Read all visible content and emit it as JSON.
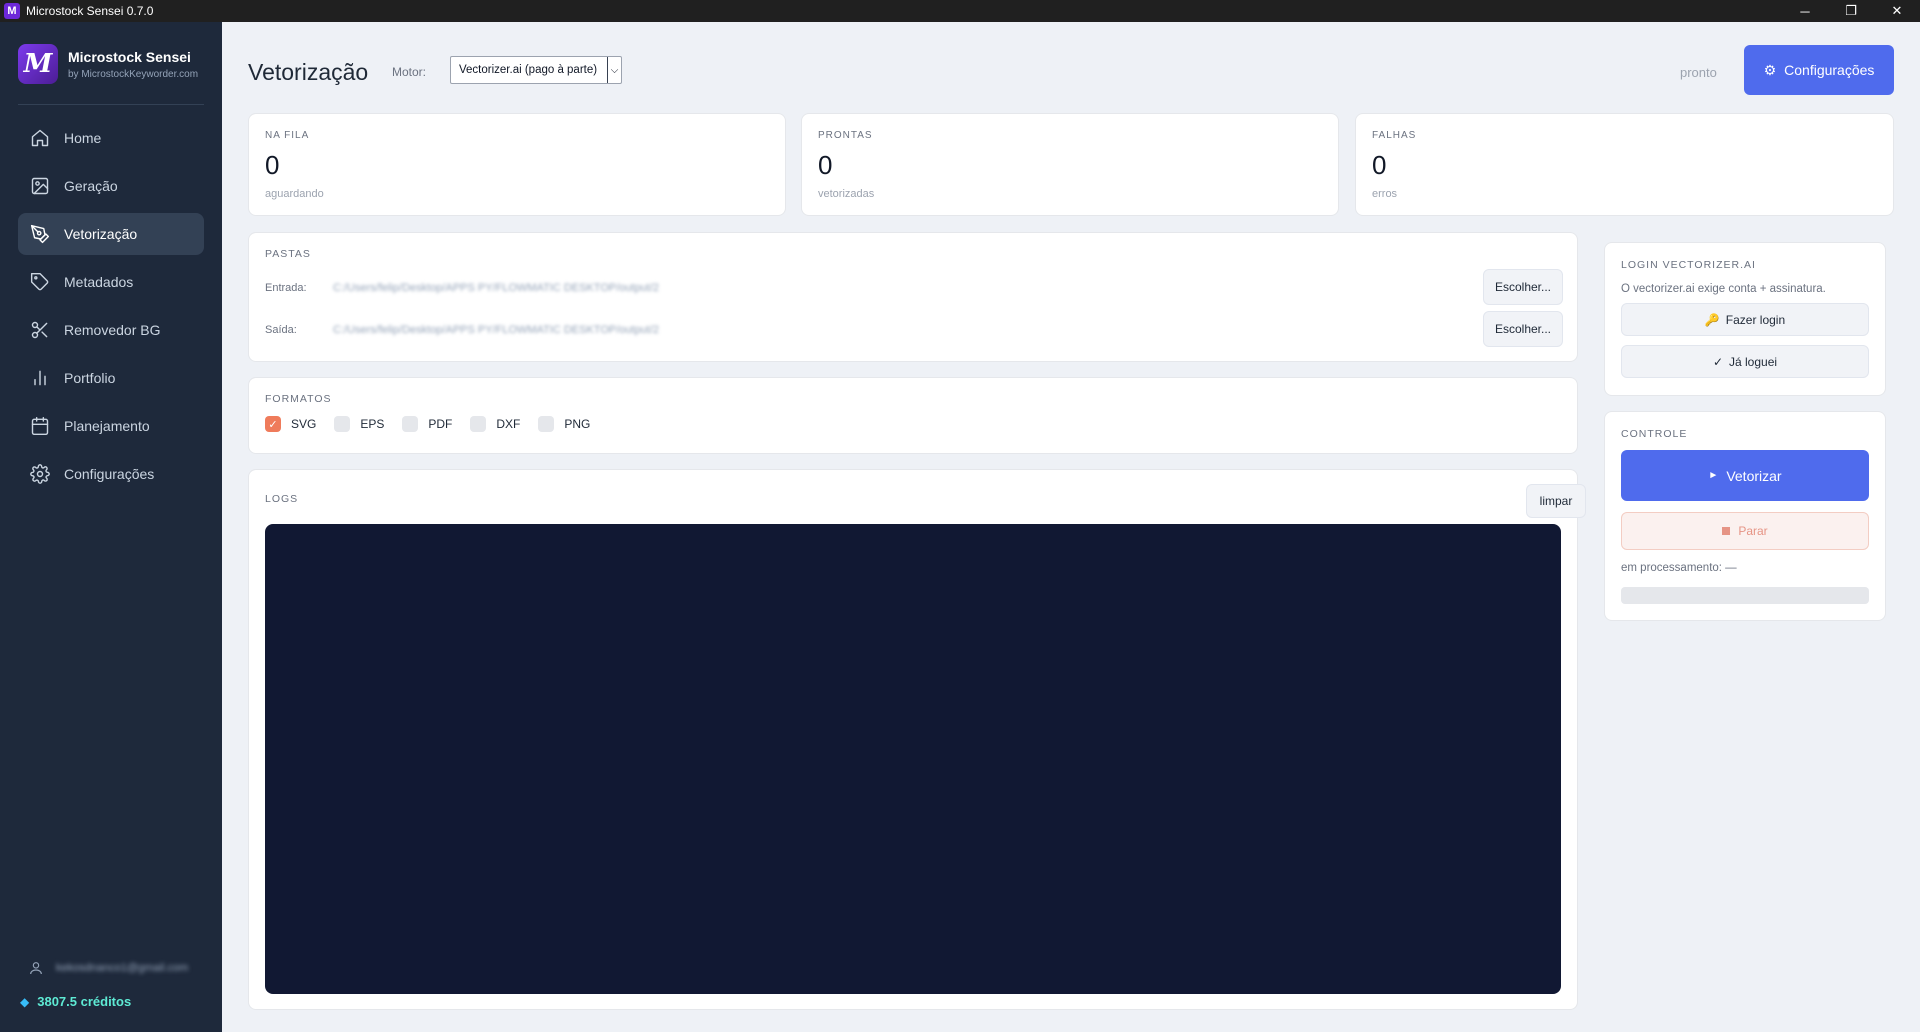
{
  "window": {
    "title": "Microstock Sensei 0.7.0",
    "minimize": "─",
    "maximize": "❐",
    "close": "✕"
  },
  "sidebar": {
    "brand_name": "Microstock Sensei",
    "brand_sub": "by MicrostockKeyworder.com",
    "logo_letter": "M",
    "items": [
      {
        "label": "Home",
        "icon": "home-icon"
      },
      {
        "label": "Geração",
        "icon": "image-icon"
      },
      {
        "label": "Vetorização",
        "icon": "pen-tool-icon",
        "active": true
      },
      {
        "label": "Metadados",
        "icon": "tag-icon"
      },
      {
        "label": "Removedor BG",
        "icon": "scissors-icon"
      },
      {
        "label": "Portfolio",
        "icon": "bar-chart-icon"
      },
      {
        "label": "Planejamento",
        "icon": "calendar-icon"
      },
      {
        "label": "Configurações",
        "icon": "gear-icon"
      }
    ],
    "user_email": "kekosdnanco1@gmail.com",
    "credits": "3807.5 créditos"
  },
  "header": {
    "title": "Vetorização",
    "motor_label": "Motor:",
    "motor_value": "Vectorizer.ai (pago à parte)",
    "status": "pronto",
    "config_button": "Configurações"
  },
  "stats": [
    {
      "label": "NA FILA",
      "value": "0",
      "sub": "aguardando"
    },
    {
      "label": "PRONTAS",
      "value": "0",
      "sub": "vetorizadas"
    },
    {
      "label": "FALHAS",
      "value": "0",
      "sub": "erros"
    }
  ],
  "folders": {
    "section_label": "PASTAS",
    "input_label": "Entrada:",
    "input_path": "C:/Users/felip/Desktop/APPS PY/FLOWMATIC DESKTOP/output/2",
    "output_label": "Saída:",
    "output_path": "C:/Users/felip/Desktop/APPS PY/FLOWMATIC DESKTOP/output/2",
    "choose_button": "Escolher..."
  },
  "formats": {
    "section_label": "FORMATOS",
    "items": [
      {
        "label": "SVG",
        "checked": true
      },
      {
        "label": "EPS",
        "checked": false
      },
      {
        "label": "PDF",
        "checked": false
      },
      {
        "label": "DXF",
        "checked": false
      },
      {
        "label": "PNG",
        "checked": false
      }
    ]
  },
  "logs": {
    "section_label": "LOGS",
    "clear_button": "limpar"
  },
  "login": {
    "section_label": "LOGIN VECTORIZER.AI",
    "description": "O vectorizer.ai exige conta + assinatura.",
    "login_button": "Fazer login",
    "login_icon": "🔑",
    "logged_button": "Já loguei",
    "logged_icon": "✓"
  },
  "control": {
    "section_label": "CONTROLE",
    "start_button": "Vetorizar",
    "start_icon": "►",
    "stop_button": "Parar",
    "processing_label": "em processamento: —",
    "progress": 0
  },
  "colors": {
    "accent": "#4f6bed",
    "sidebar": "#1e293b",
    "checkbox_on": "#ef7b5b",
    "logs_bg": "#111833"
  }
}
